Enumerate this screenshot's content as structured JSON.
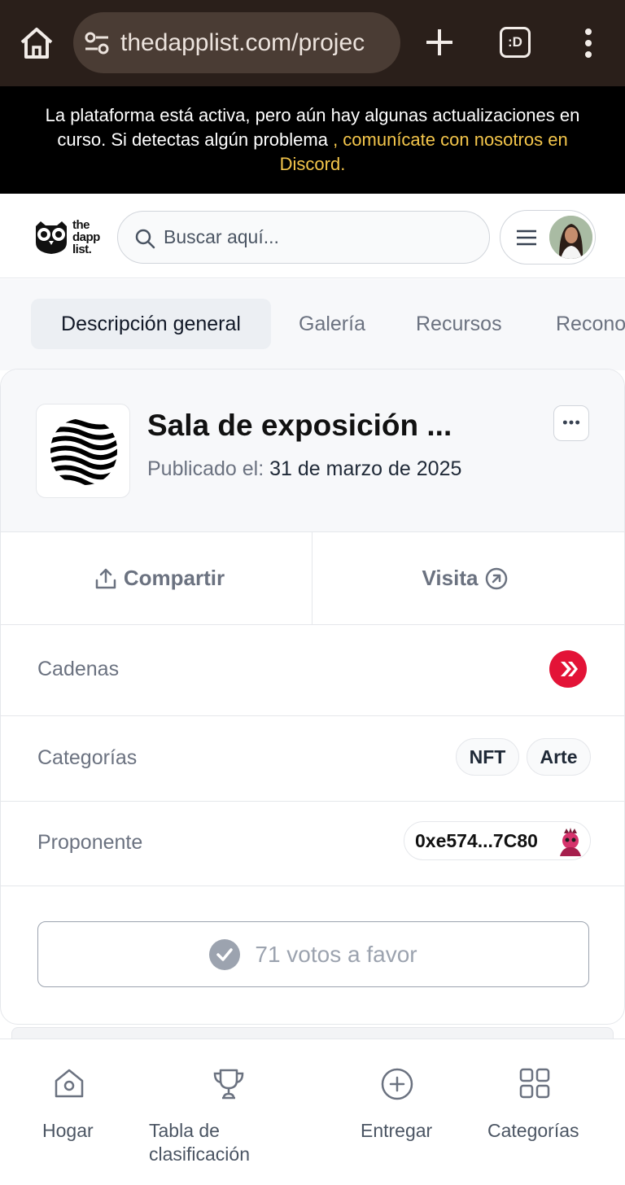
{
  "browser": {
    "url": "thedapplist.com/projec",
    "tabs_label": ":D"
  },
  "banner": {
    "text": "La plataforma está activa, pero aún hay algunas actualizaciones en curso. Si detectas algún problema ",
    "link": ", comunícate con nosotros en Discord."
  },
  "header": {
    "logo_lines": [
      "the",
      "dapp",
      "list."
    ],
    "search_placeholder": "Buscar aquí..."
  },
  "tabs": [
    {
      "label": "Descripción general",
      "active": true
    },
    {
      "label": "Galería",
      "active": false
    },
    {
      "label": "Recursos",
      "active": false
    },
    {
      "label": "Recono",
      "active": false
    }
  ],
  "project": {
    "title": "Sala de exposición ...",
    "published_label": "Publicado el:",
    "published_date": "31 de marzo de 2025"
  },
  "actions": {
    "share": "Compartir",
    "visit": "Visita"
  },
  "details": {
    "chains_label": "Cadenas",
    "chain_color": "#e31337",
    "categories_label": "Categorías",
    "categories": [
      "NFT",
      "Arte"
    ],
    "proposer_label": "Proponente",
    "proposer_address": "0xe574...7C80"
  },
  "vote": {
    "label": "71 votos a favor"
  },
  "bottom_nav": [
    {
      "label": "Hogar",
      "icon": "home-icon"
    },
    {
      "label": "Tabla de clasificación",
      "icon": "trophy-icon"
    },
    {
      "label": "Entregar",
      "icon": "plus-circle-icon"
    },
    {
      "label": "Categorías",
      "icon": "grid-icon"
    }
  ]
}
